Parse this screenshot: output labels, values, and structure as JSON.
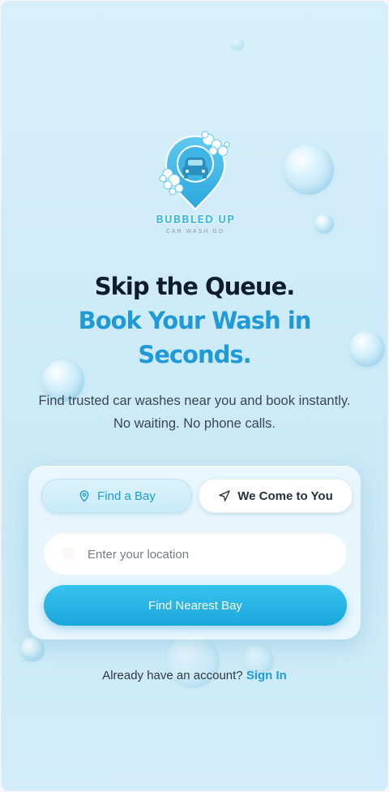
{
  "brand": {
    "name": "BUBBLED UP",
    "tagline": "CAR WASH GO"
  },
  "hero": {
    "line1": "Skip the Queue.",
    "line2": "Book Your Wash in",
    "line3": "Seconds.",
    "subtitle": "Find trusted car washes near you and book instantly. No waiting. No phone calls."
  },
  "booking_card": {
    "tabs": [
      {
        "label": "Find a Bay",
        "icon": "map-pin-icon",
        "active": true
      },
      {
        "label": "We Come to You",
        "icon": "navigation-arrow-icon",
        "active": false
      }
    ],
    "location_input": {
      "placeholder": "Enter your location",
      "value": ""
    },
    "cta_label": "Find Nearest Bay"
  },
  "footer": {
    "prompt": "Already have an account?",
    "link_label": "Sign In"
  },
  "colors": {
    "accent": "#1f9ad6",
    "headline_dark": "#0f1b2e",
    "background": "#cdeaf7",
    "cta": "#1ba7dc"
  }
}
